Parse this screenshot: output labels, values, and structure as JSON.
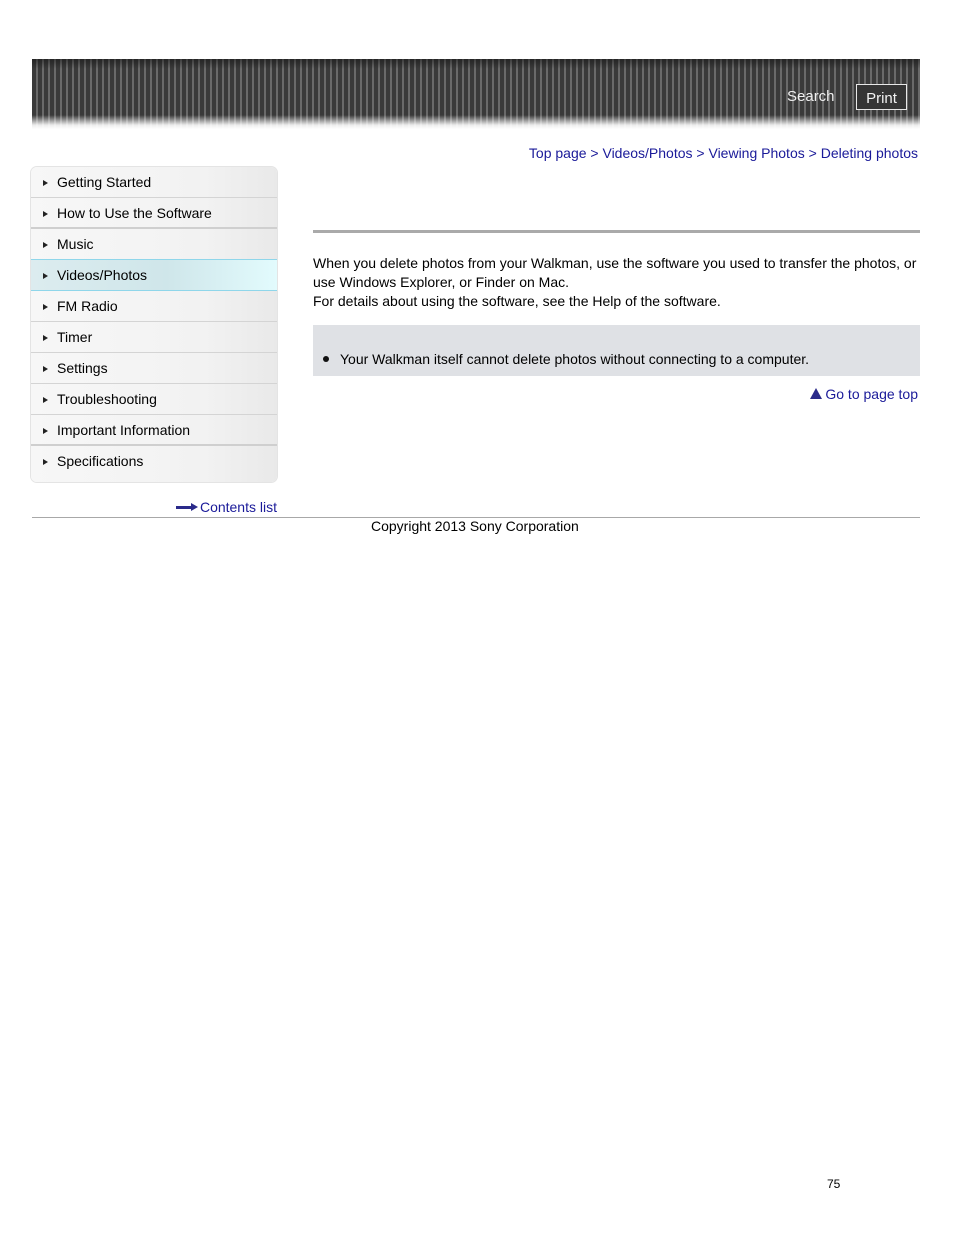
{
  "header": {
    "search_label": "Search",
    "print_label": "Print"
  },
  "breadcrumb": {
    "items": [
      "Top page",
      "Videos/Photos",
      "Viewing Photos",
      "Deleting photos"
    ],
    "separator": ">"
  },
  "sidebar": {
    "items": [
      {
        "label": "Getting Started"
      },
      {
        "label": "How to Use the Software"
      },
      {
        "label": "Music"
      },
      {
        "label": "Videos/Photos",
        "active": true
      },
      {
        "label": "FM Radio"
      },
      {
        "label": "Timer"
      },
      {
        "label": "Settings"
      },
      {
        "label": "Troubleshooting"
      },
      {
        "label": "Important Information"
      },
      {
        "label": "Specifications"
      }
    ],
    "contents_list_label": "Contents list"
  },
  "main": {
    "title": "",
    "paragraphs": [
      "When you delete photos from your Walkman, use the software you used to transfer the photos, or use Windows Explorer, or Finder on Mac.",
      "For details about using the software, see the Help of the software."
    ],
    "note_items": [
      "Your Walkman itself cannot delete photos without connecting to a computer."
    ],
    "go_to_top_label": "Go to page top"
  },
  "footer": {
    "copyright": "Copyright 2013 Sony Corporation",
    "page_number": "75"
  },
  "colors": {
    "link": "#1a1a99",
    "active_nav_border": "#8fd6ea",
    "note_background": "#dfe1e5"
  }
}
